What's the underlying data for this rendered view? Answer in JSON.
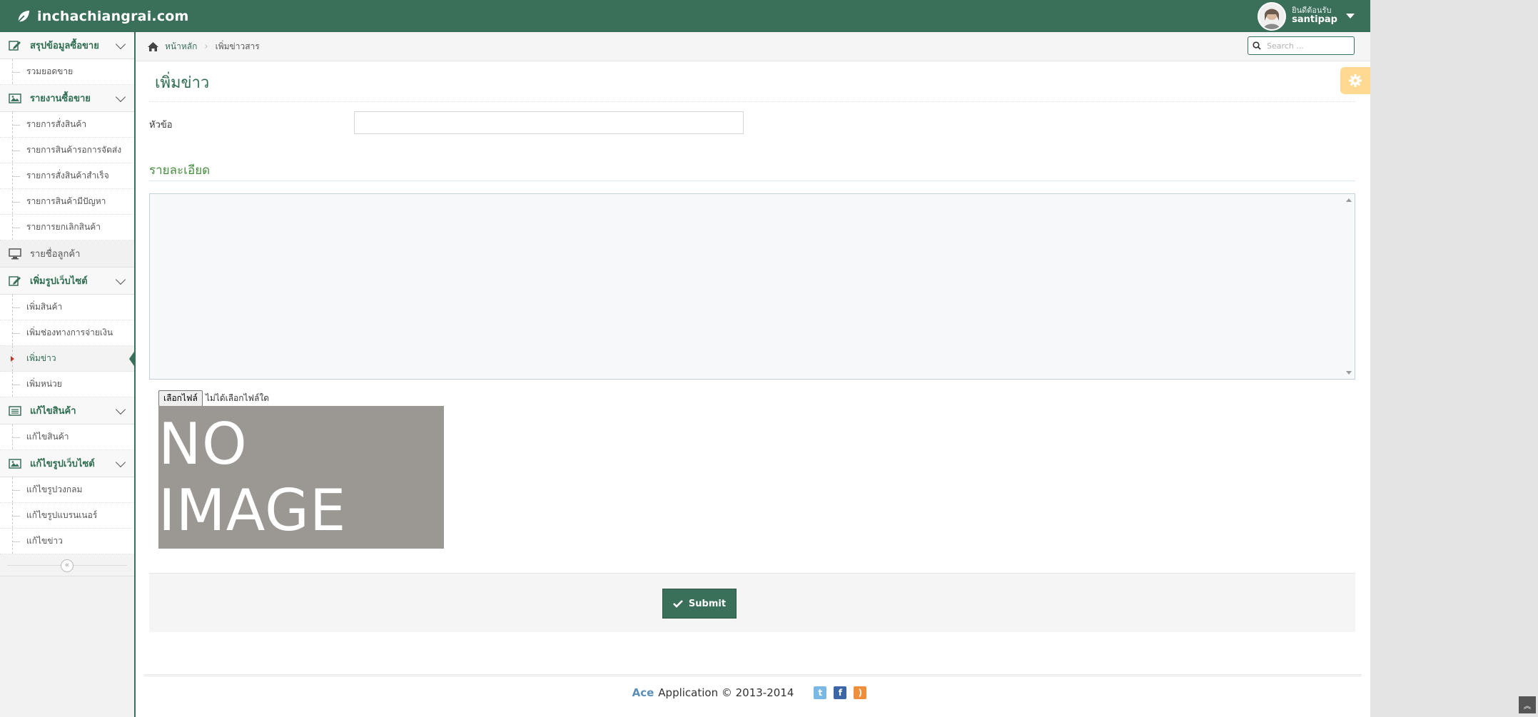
{
  "brand": {
    "name": "inchachiangrai.com"
  },
  "user": {
    "welcome": "ยินดีต้อนรับ",
    "username": "santipap"
  },
  "sidebar": {
    "groups": [
      {
        "label": "สรุปข้อมูลซื้อขาย",
        "items": [
          "รวมยอดขาย"
        ]
      },
      {
        "label": "รายงานซื้อขาย",
        "items": [
          "รายการสั่งสินค้า",
          "รายการสินค้ารอการจัดส่ง",
          "รายการสั่งสินค้าสำเร็จ",
          "รายการสินค้ามีปัญหา",
          "รายการยกเลิกสินค้า"
        ]
      },
      {
        "label": "รายชื่อลูกค้า",
        "items": []
      },
      {
        "label": "เพิ่มรูปเว็บไซต์",
        "items": [
          "เพิ่มสินค้า",
          "เพิ่มช่องทางการจ่ายเงิน",
          "เพิ่มข่าว",
          "เพิ่มหน่วย"
        ]
      },
      {
        "label": "แก้ไขสินค้า",
        "items": [
          "แก้ไขสินค้า"
        ]
      },
      {
        "label": "แก้ไขรูปเว็บไซต์",
        "items": [
          "แก้ไขรูปวงกลม",
          "แก้ไขรูปแบรนเนอร์",
          "แก้ไขข่าว"
        ]
      }
    ]
  },
  "breadcrumb": {
    "home": "หน้าหลัก",
    "current": "เพิ่มข่าวสาร"
  },
  "search": {
    "placeholder": "Search ..."
  },
  "page": {
    "title": "เพิ่มข่าว"
  },
  "form": {
    "title_label": "หัวข้อ",
    "title_value": "",
    "details_heading": "รายละเอียด",
    "file_button": "เลือกไฟล์",
    "file_status": "ไม่ได้เลือกไฟล์ใด",
    "image_placeholder": "NO IMAGE",
    "submit_label": "Submit"
  },
  "footer": {
    "brand": "Ace",
    "text": "Application © 2013-2014"
  },
  "colors": {
    "primary": "#3a6f5a",
    "section_heading": "#478d3f",
    "settings": "#ffc657"
  }
}
